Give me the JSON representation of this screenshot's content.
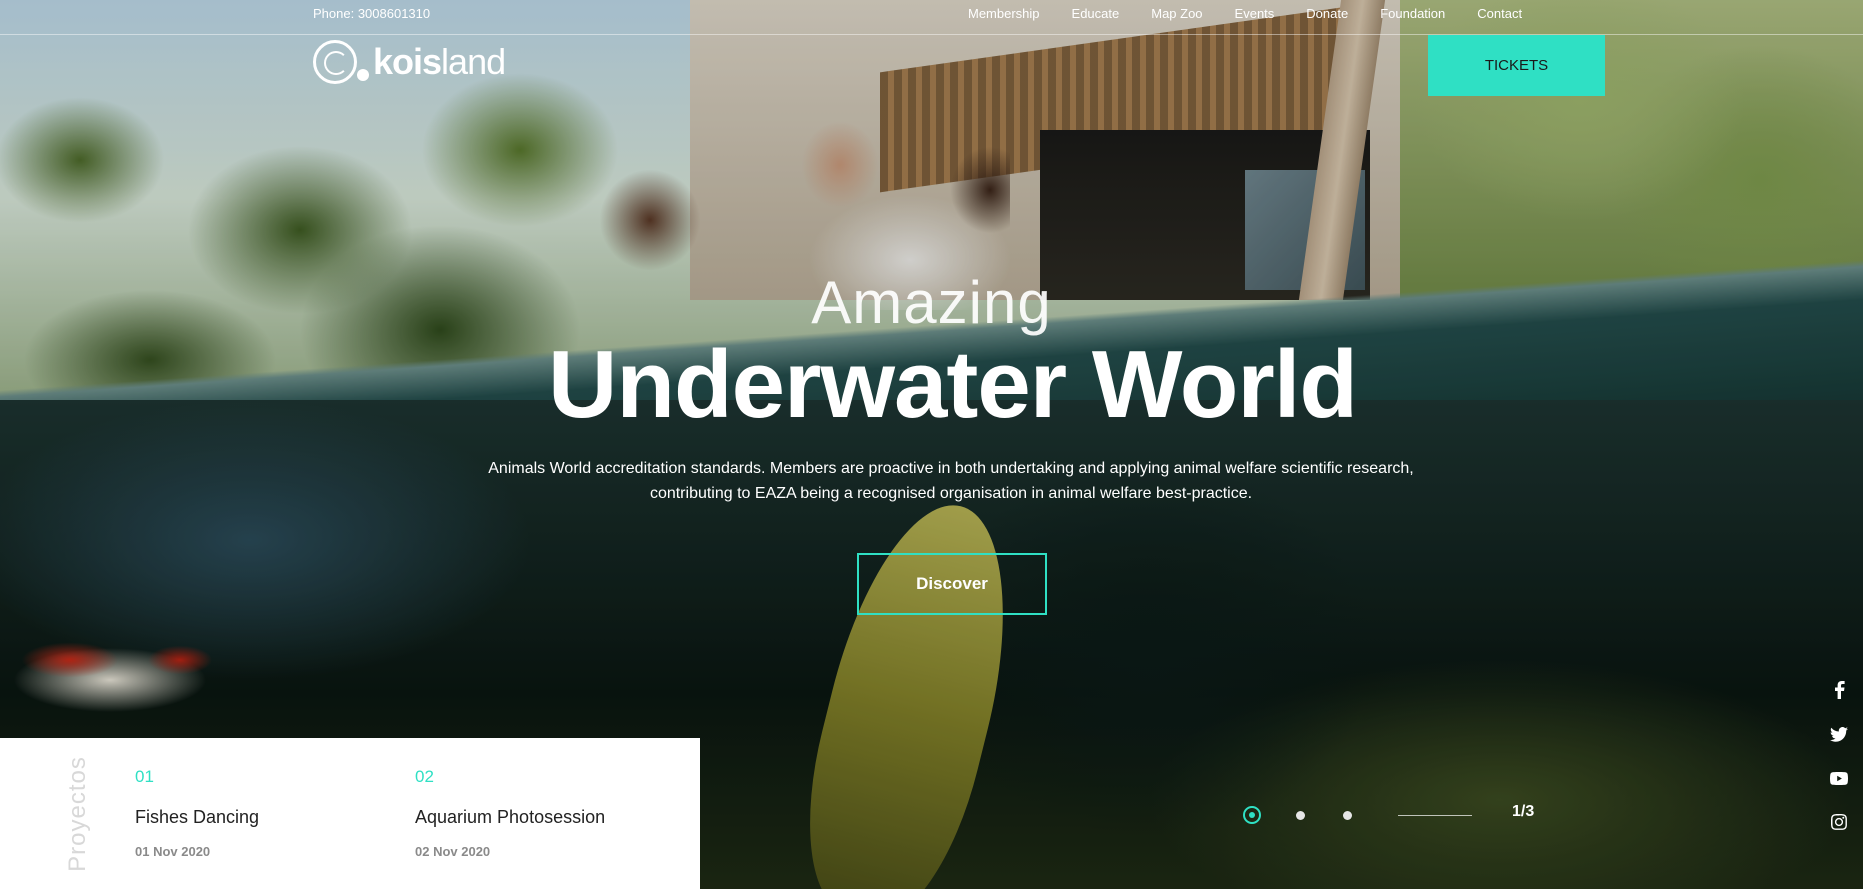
{
  "header": {
    "phone": "Phone: 3008601310",
    "nav": [
      "Membership",
      "Educate",
      "Map Zoo",
      "Events",
      "Donate",
      "Foundation",
      "Contact"
    ],
    "logo_text_bold": "kois",
    "logo_text_light": "land",
    "tickets_label": "TICKETS"
  },
  "hero": {
    "eyebrow": "Amazing",
    "headline": "Underwater World",
    "subtext_line1": "Animals World accreditation standards. Members are proactive in both undertaking and applying animal welfare scientific research,",
    "subtext_line2": "contributing to EAZA being a recognised organisation in animal welfare best-practice.",
    "discover_label": "Discover"
  },
  "projects": {
    "label": "Proyectos",
    "items": [
      {
        "num": "01",
        "title": "Fishes Dancing",
        "date": "01 Nov 2020"
      },
      {
        "num": "02",
        "title": "Aquarium Photosession",
        "date": "02 Nov 2020"
      }
    ]
  },
  "slider": {
    "counter": "1/3",
    "active_index": 0,
    "total": 3
  },
  "social": [
    "facebook-icon",
    "twitter-icon",
    "youtube-icon",
    "instagram-icon"
  ],
  "colors": {
    "accent": "#2fe0c4"
  }
}
